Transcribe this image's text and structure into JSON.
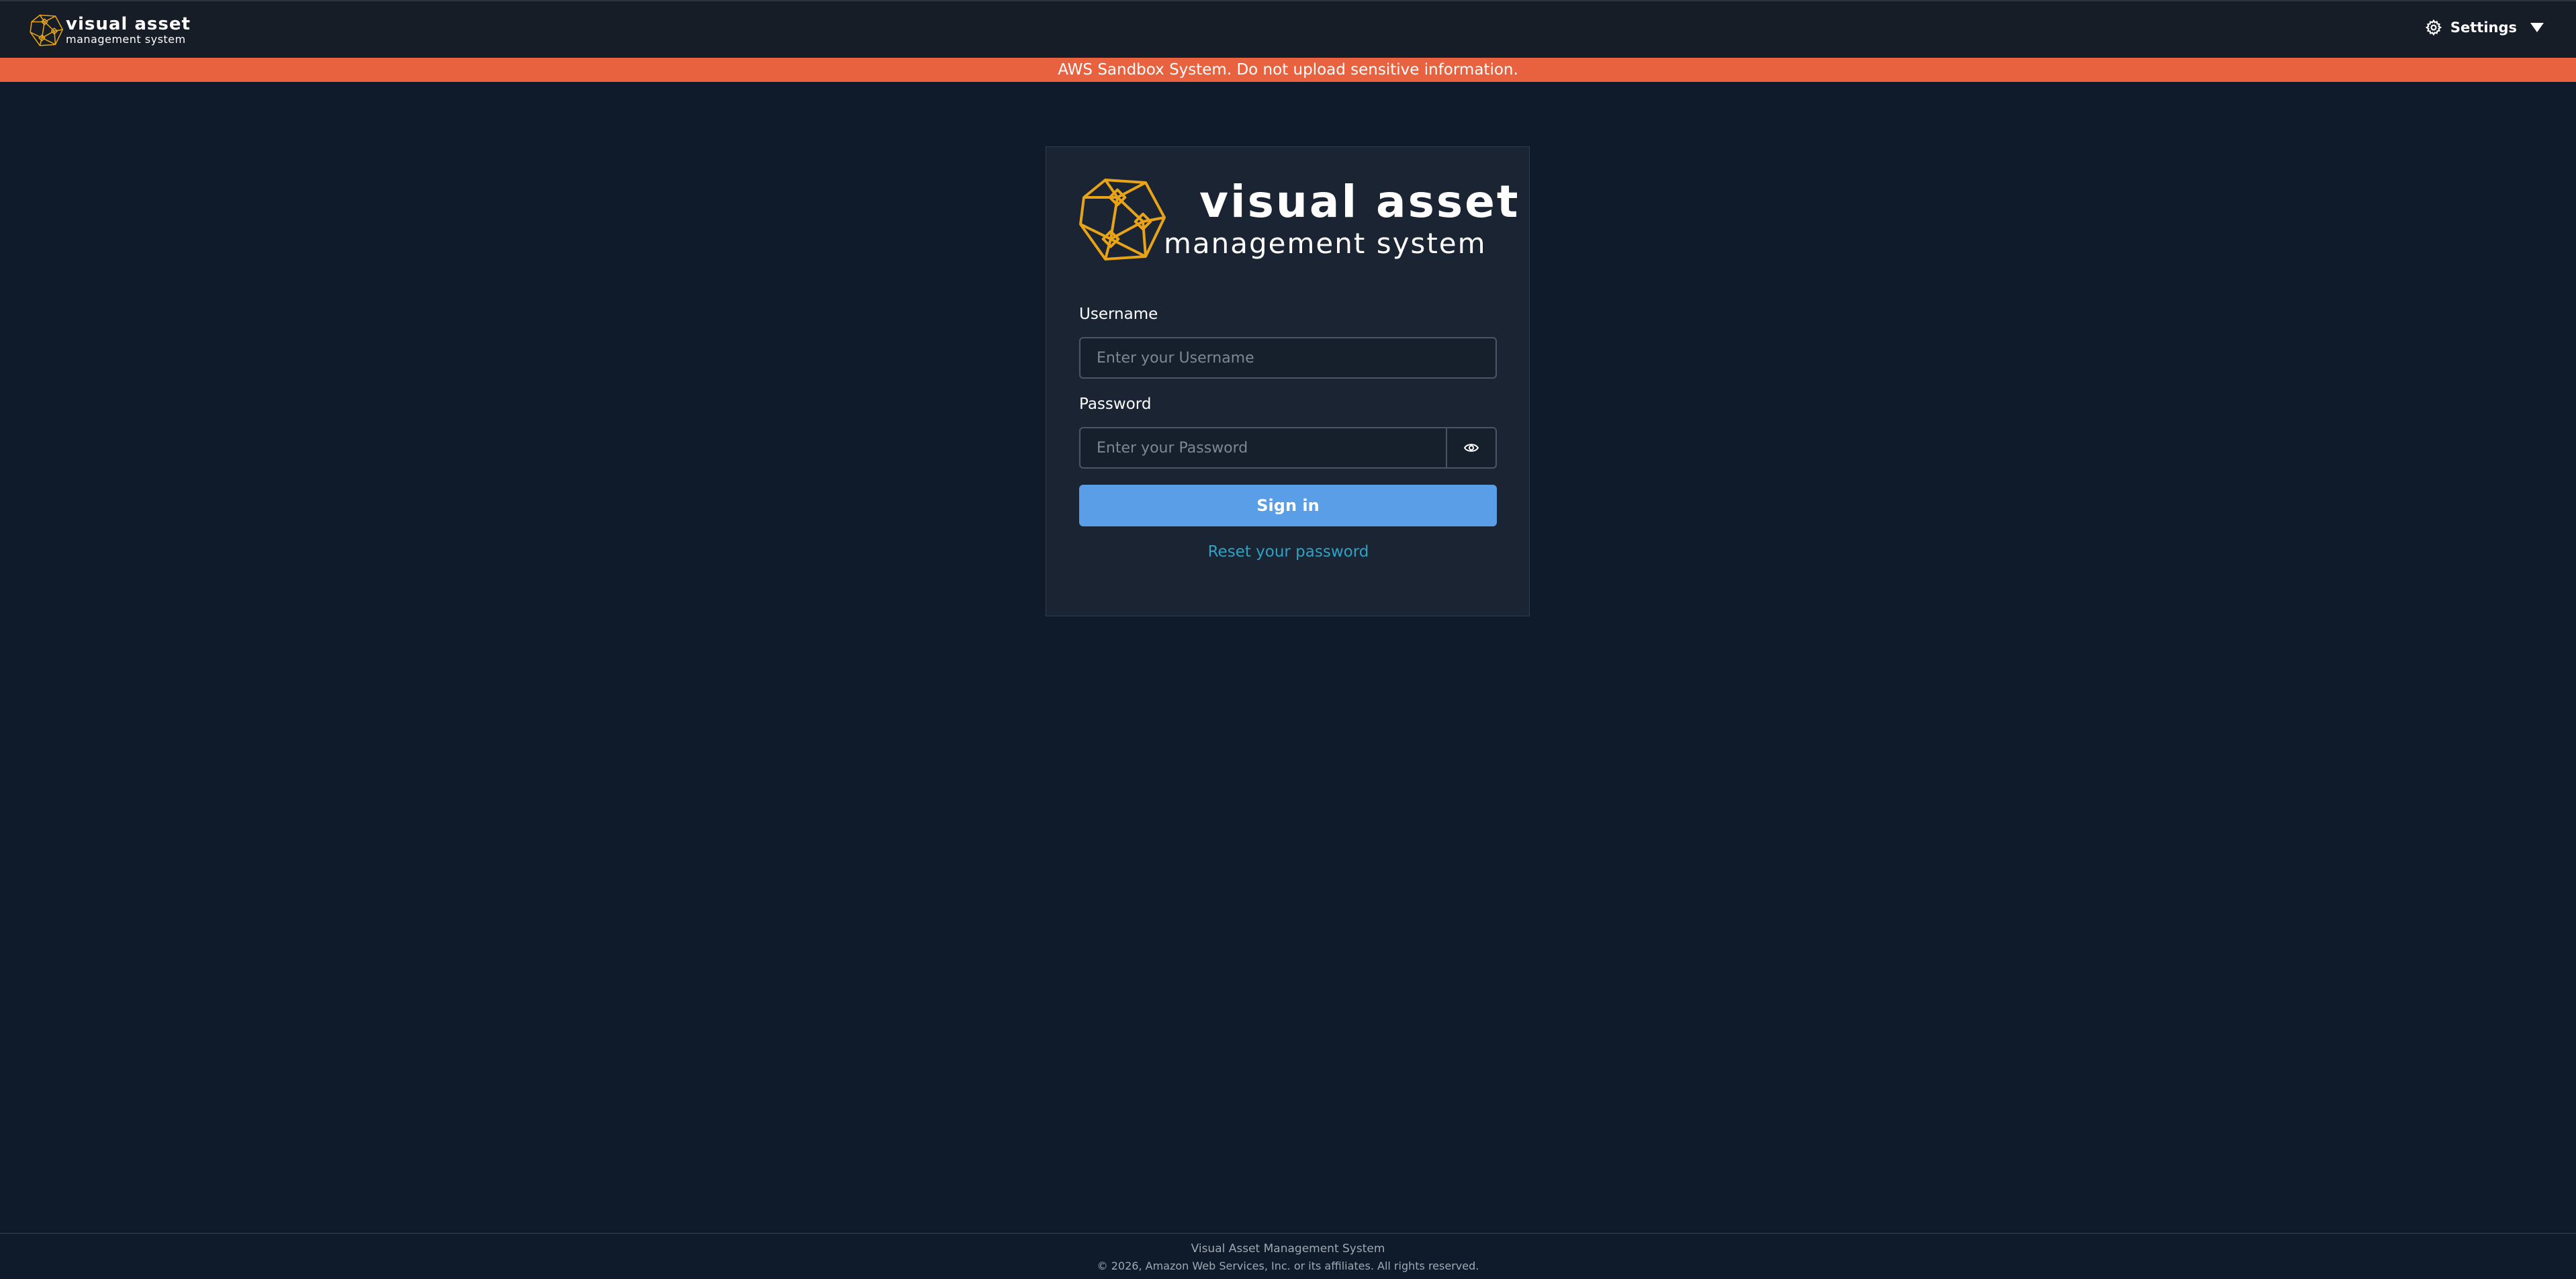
{
  "header": {
    "logo_line1": "visual asset",
    "logo_line2": "management system",
    "settings_label": "Settings",
    "settings_icon": "gear-icon",
    "dropdown_icon": "caret-down-icon"
  },
  "banner": {
    "text": "AWS Sandbox System. Do not upload sensitive information.",
    "color": "#e8623f"
  },
  "login": {
    "logo_line1": "visual asset",
    "logo_line2": "management system",
    "username_label": "Username",
    "username_placeholder": "Enter your Username",
    "password_label": "Password",
    "password_placeholder": "Enter your Password",
    "show_password_icon": "eye-icon",
    "signin_label": "Sign in",
    "reset_label": "Reset your password",
    "accent_color": "#5b9ee8",
    "link_color": "#2fa2c4",
    "logo_color": "#e8a317"
  },
  "footer": {
    "line1": "Visual Asset Management System",
    "line2": "© 2026, Amazon Web Services, Inc. or its affiliates. All rights reserved."
  }
}
